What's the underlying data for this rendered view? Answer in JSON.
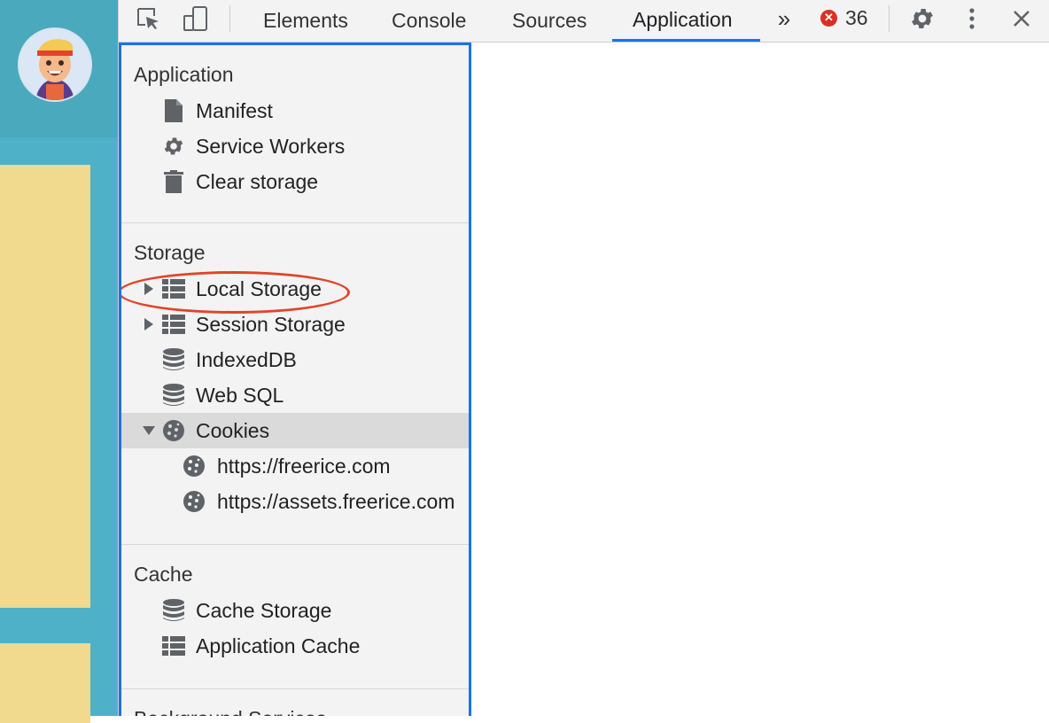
{
  "toolbar": {
    "tabs": [
      {
        "label": "Elements"
      },
      {
        "label": "Console"
      },
      {
        "label": "Sources"
      },
      {
        "label": "Application"
      }
    ],
    "more_tabs_glyph": "»",
    "error_count": "36",
    "icons": [
      "inspect-element-icon",
      "device-toolbar-icon",
      "more-tabs-icon",
      "error-icon",
      "settings-gear-icon",
      "kebab-menu-icon",
      "close-icon"
    ]
  },
  "sidebar": {
    "sections": [
      {
        "title": "Application",
        "items": [
          {
            "label": "Manifest",
            "icon": "document-icon"
          },
          {
            "label": "Service Workers",
            "icon": "gear-icon"
          },
          {
            "label": "Clear storage",
            "icon": "trash-icon"
          }
        ]
      },
      {
        "title": "Storage",
        "items": [
          {
            "label": "Local Storage",
            "icon": "grid-table-icon",
            "expandable": true,
            "expanded": false,
            "annotated": true
          },
          {
            "label": "Session Storage",
            "icon": "grid-table-icon",
            "expandable": true,
            "expanded": false
          },
          {
            "label": "IndexedDB",
            "icon": "database-icon"
          },
          {
            "label": "Web SQL",
            "icon": "database-icon"
          },
          {
            "label": "Cookies",
            "icon": "cookie-icon",
            "expandable": true,
            "expanded": true,
            "selected": true,
            "children": [
              {
                "label": "https://freerice.com",
                "icon": "cookie-icon"
              },
              {
                "label": "https://assets.freerice.com",
                "icon": "cookie-icon"
              }
            ]
          }
        ]
      },
      {
        "title": "Cache",
        "items": [
          {
            "label": "Cache Storage",
            "icon": "database-icon"
          },
          {
            "label": "Application Cache",
            "icon": "grid-table-icon"
          }
        ]
      },
      {
        "title": "Background Services",
        "items": []
      }
    ]
  },
  "colors": {
    "accent": "#1a73e8",
    "annotation": "#e2432a",
    "error": "#d93025",
    "page_background": "#4fb1c8",
    "page_card": "#f1d98d"
  }
}
